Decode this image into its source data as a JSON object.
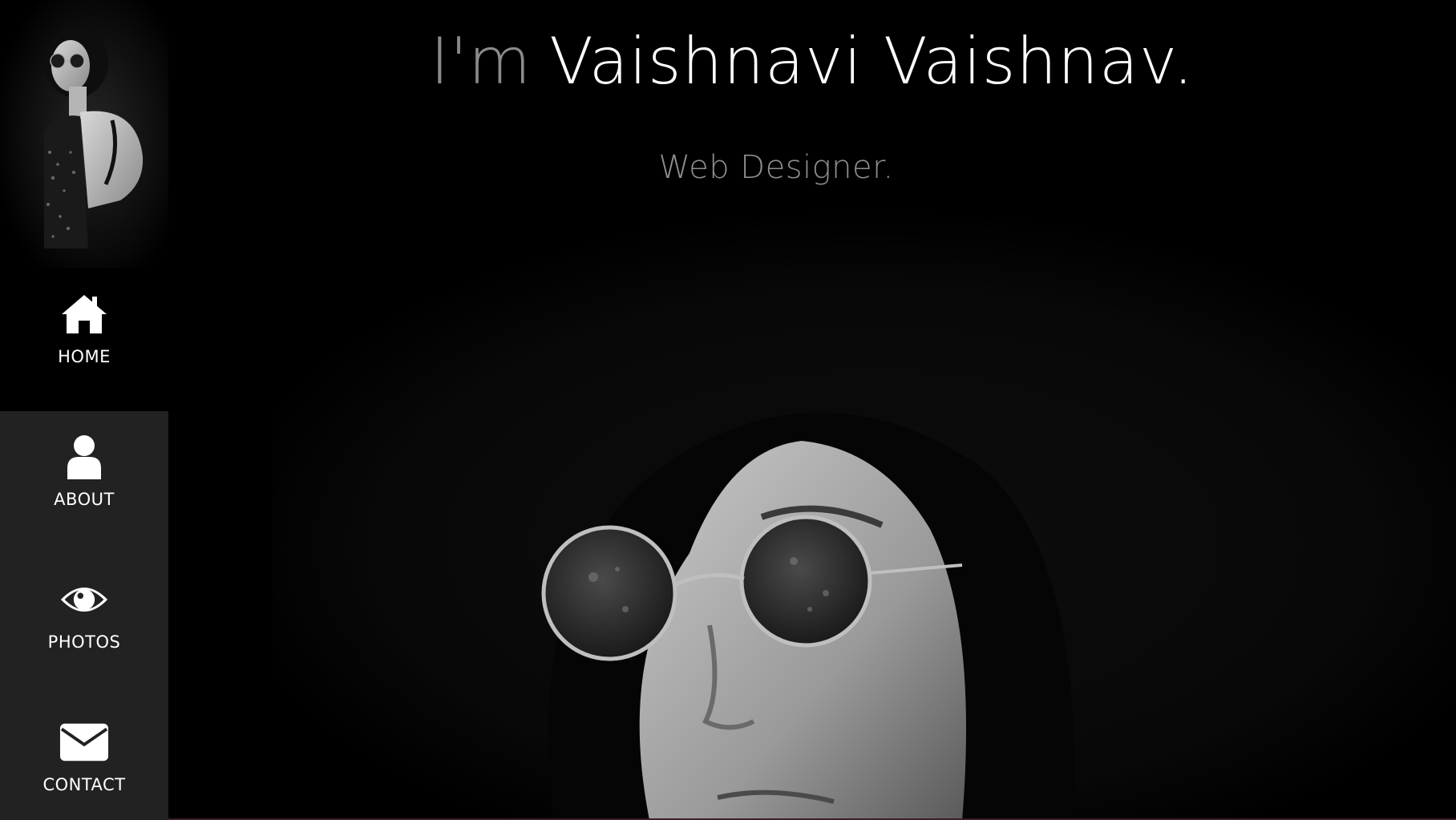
{
  "sidebar": {
    "profile_photo": "profile-portrait-photo",
    "items": [
      {
        "label": "HOME",
        "icon": "home-icon",
        "active": true
      },
      {
        "label": "ABOUT",
        "icon": "user-icon",
        "active": false
      },
      {
        "label": "PHOTOS",
        "icon": "eye-icon",
        "active": false
      },
      {
        "label": "CONTACT",
        "icon": "envelope-icon",
        "active": false
      }
    ]
  },
  "hero": {
    "prefix": "I'm",
    "name": "Vaishnavi Vaishnav.",
    "role": "Web Designer.",
    "photo": "hero-portrait-photo"
  },
  "colors": {
    "background": "#000000",
    "sidebar_lower": "#222222",
    "text_primary": "#ffffff",
    "text_muted": "#8a8a8a"
  }
}
